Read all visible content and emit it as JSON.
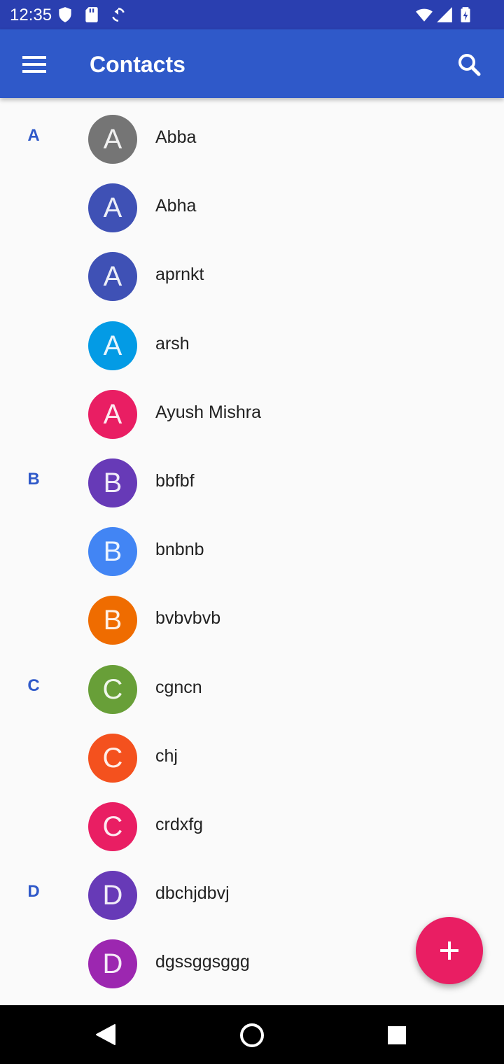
{
  "status_bar": {
    "time": "12:35",
    "icons": [
      "shield-icon",
      "sd-card-icon",
      "sync-icon",
      "wifi-icon",
      "cell-signal-icon",
      "battery-icon"
    ]
  },
  "app_bar": {
    "title": "Contacts",
    "menu_icon": "menu-icon",
    "search_icon": "search-icon"
  },
  "contacts": [
    {
      "section": "A",
      "initial": "A",
      "name": "Abba",
      "color": "#757575"
    },
    {
      "section": "",
      "initial": "A",
      "name": "Abha",
      "color": "#3f51b5"
    },
    {
      "section": "",
      "initial": "A",
      "name": "aprnkt",
      "color": "#3f51b5"
    },
    {
      "section": "",
      "initial": "A",
      "name": "arsh",
      "color": "#039be5"
    },
    {
      "section": "",
      "initial": "A",
      "name": "Ayush Mishra",
      "color": "#e91e63"
    },
    {
      "section": "B",
      "initial": "B",
      "name": "bbfbf",
      "color": "#673ab7"
    },
    {
      "section": "",
      "initial": "B",
      "name": "bnbnb",
      "color": "#4285f4"
    },
    {
      "section": "",
      "initial": "B",
      "name": "bvbvbvb",
      "color": "#ef6c00"
    },
    {
      "section": "C",
      "initial": "C",
      "name": "cgncn",
      "color": "#689f38"
    },
    {
      "section": "",
      "initial": "C",
      "name": "chj",
      "color": "#f4511e"
    },
    {
      "section": "",
      "initial": "C",
      "name": "crdxfg",
      "color": "#e91e63"
    },
    {
      "section": "D",
      "initial": "D",
      "name": "dbchjdbvj",
      "color": "#673ab7"
    },
    {
      "section": "",
      "initial": "D",
      "name": "dgssggsggg",
      "color": "#9c27b0"
    }
  ],
  "fab": {
    "icon": "plus-icon",
    "color": "#e91e63"
  },
  "nav_bar": {
    "icons": [
      "back-icon",
      "home-icon",
      "recents-icon"
    ]
  },
  "colors": {
    "status_bar": "#2a3fb0",
    "app_bar": "#2f59c9",
    "section_letter": "#2f59c9"
  }
}
